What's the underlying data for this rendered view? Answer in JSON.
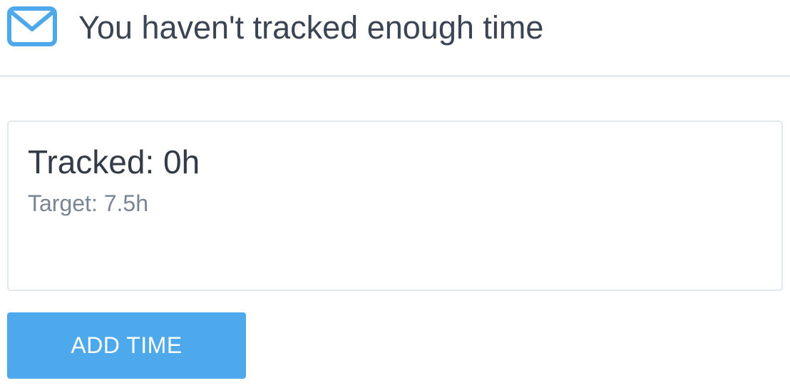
{
  "header": {
    "icon": "envelope-icon",
    "title": "You haven't tracked enough time"
  },
  "summary": {
    "tracked": "Tracked: 0h",
    "target": "Target: 7.5h"
  },
  "actions": {
    "add_time_label": "ADD TIME"
  },
  "colors": {
    "accent": "#4ea8ec",
    "title_text": "#3b4452",
    "muted_text": "#7a8594",
    "divider": "#e6ebf0"
  }
}
